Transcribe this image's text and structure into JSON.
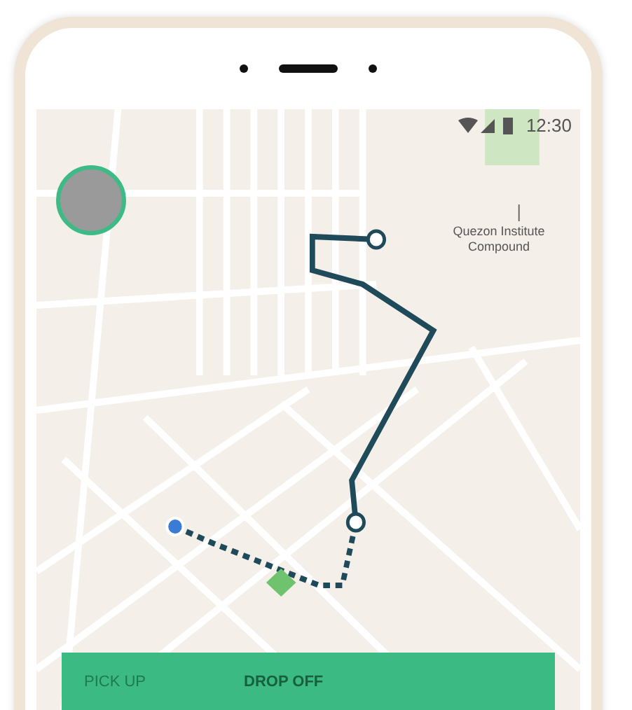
{
  "status_bar": {
    "time": "12:30"
  },
  "map": {
    "place_label": "Quezon Institute Compound"
  },
  "trip_card": {
    "tabs": [
      {
        "label": "PICK UP",
        "selected": false
      },
      {
        "label": "DROP OFF",
        "selected": true
      }
    ]
  }
}
